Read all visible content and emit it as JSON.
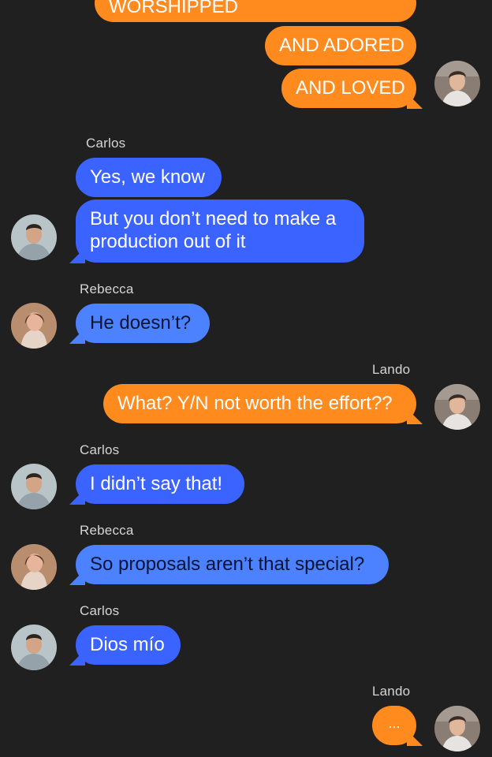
{
  "colors": {
    "background": "#202020",
    "self_bubble": "#ff8b1f",
    "carlos_bubble": "#3b63ff",
    "rebecca_bubble": "#4c82ff",
    "sender_text": "#d5d5d5"
  },
  "participants": {
    "self": "Lando",
    "carlos": "Carlos",
    "rebecca": "Rebecca"
  },
  "messages": [
    {
      "sender": "Lando",
      "text": "WORSHIPPED"
    },
    {
      "sender": "Lando",
      "text": "AND ADORED"
    },
    {
      "sender": "Lando",
      "text": "AND LOVED"
    },
    {
      "sender": "Carlos",
      "text": "Yes, we know"
    },
    {
      "sender": "Carlos",
      "lines": [
        "But you don’t need to make a",
        "production out of it"
      ]
    },
    {
      "sender": "Rebecca",
      "text": "He doesn’t?"
    },
    {
      "sender": "Lando",
      "text": "What? Y/N not worth the effort??"
    },
    {
      "sender": "Carlos",
      "text": "I didn’t say that!"
    },
    {
      "sender": "Rebecca",
      "text": "So proposals aren’t that special?"
    },
    {
      "sender": "Carlos",
      "text": "Dios mío"
    },
    {
      "sender": "Lando",
      "text": "..."
    }
  ],
  "avatars": {
    "lando": "avatar-photo-lando",
    "carlos": "avatar-photo-carlos",
    "rebecca": "avatar-photo-rebecca"
  }
}
